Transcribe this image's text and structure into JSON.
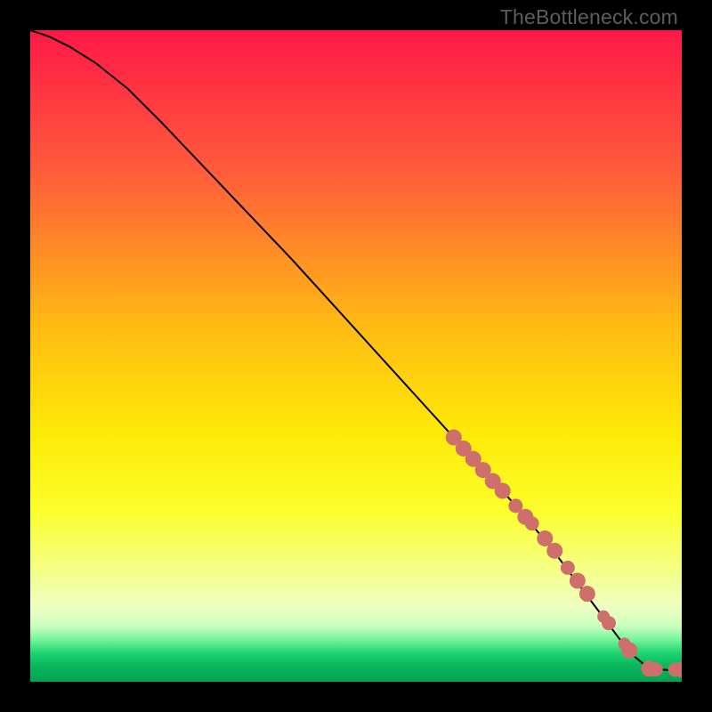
{
  "watermark": "TheBottleneck.com",
  "colors": {
    "black": "#000000",
    "curve": "#000000",
    "dot": "#cf6f6b",
    "gradient_stops": [
      {
        "offset": 0.0,
        "color": "#ff1847"
      },
      {
        "offset": 0.22,
        "color": "#ff5d3a"
      },
      {
        "offset": 0.45,
        "color": "#ffb914"
      },
      {
        "offset": 0.62,
        "color": "#feea06"
      },
      {
        "offset": 0.74,
        "color": "#fbff2d"
      },
      {
        "offset": 0.82,
        "color": "#f5ff7e"
      },
      {
        "offset": 0.885,
        "color": "#eeffc2"
      },
      {
        "offset": 0.915,
        "color": "#c9ffbf"
      },
      {
        "offset": 0.935,
        "color": "#75f59a"
      },
      {
        "offset": 0.955,
        "color": "#1fd672"
      },
      {
        "offset": 0.975,
        "color": "#09b85c"
      },
      {
        "offset": 1.0,
        "color": "#04a24e"
      }
    ]
  },
  "chart_data": {
    "type": "line",
    "title": "",
    "xlabel": "",
    "ylabel": "",
    "xlim": [
      0,
      100
    ],
    "ylim": [
      0,
      100
    ],
    "series": [
      {
        "name": "curve",
        "x": [
          0,
          3,
          6,
          10,
          15,
          20,
          30,
          40,
          50,
          60,
          65,
          70,
          75,
          80,
          83,
          86,
          89,
          92,
          95,
          98,
          100
        ],
        "y": [
          100,
          99,
          97.5,
          95,
          91,
          86,
          75.5,
          65,
          54,
          43,
          37.5,
          32,
          26.5,
          20.5,
          16.5,
          12.5,
          8.5,
          4.5,
          2.0,
          1.8,
          1.9
        ]
      }
    ],
    "dots": {
      "name": "highlight-points",
      "x": [
        65,
        66.5,
        68,
        69.5,
        71,
        72.5,
        74.5,
        76,
        77,
        79,
        80.5,
        82.5,
        84,
        85.5,
        88,
        88.8,
        91.2,
        92,
        95,
        96,
        99,
        100
      ],
      "y": [
        37.5,
        35.8,
        34.2,
        32.5,
        30.8,
        29.3,
        27.0,
        25.3,
        24.3,
        22.0,
        20.1,
        17.5,
        15.5,
        13.5,
        10.0,
        9.0,
        5.8,
        4.8,
        2.0,
        1.9,
        1.85,
        1.9
      ],
      "r": [
        9,
        9,
        9,
        9,
        9,
        9,
        8,
        9,
        8,
        9,
        9,
        8,
        9,
        9,
        7,
        8,
        7,
        9,
        9,
        8,
        8,
        9
      ]
    }
  }
}
